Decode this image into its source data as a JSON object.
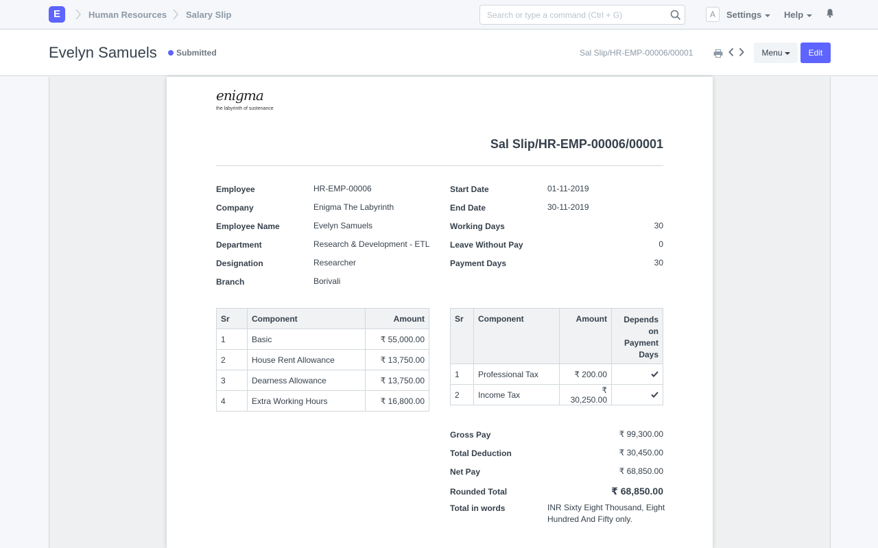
{
  "navbar": {
    "logo": "E",
    "breadcrumbs": [
      "Human Resources",
      "Salary Slip"
    ],
    "search_placeholder": "Search or type a command (Ctrl + G)",
    "avatar": "A",
    "settings": "Settings",
    "help": "Help"
  },
  "header": {
    "title": "Evelyn Samuels",
    "status": "Submitted",
    "doc_name": "Sal Slip/HR-EMP-00006/00001",
    "menu": "Menu",
    "edit": "Edit"
  },
  "slip": {
    "brand": "enigma",
    "tagline": "the labyrinth of sustenance",
    "title": "Sal Slip/HR-EMP-00006/00001",
    "left_fields": [
      {
        "label": "Employee",
        "value": "HR-EMP-00006"
      },
      {
        "label": "Company",
        "value": "Enigma The Labyrinth"
      },
      {
        "label": "Employee Name",
        "value": "Evelyn Samuels"
      },
      {
        "label": "Department",
        "value": "Research & Development - ETL"
      },
      {
        "label": "Designation",
        "value": "Researcher"
      },
      {
        "label": "Branch",
        "value": "Borivali"
      }
    ],
    "right_fields": [
      {
        "label": "Start Date",
        "value": "01-11-2019"
      },
      {
        "label": "End Date",
        "value": "30-11-2019"
      },
      {
        "label": "Working Days",
        "value": "30"
      },
      {
        "label": "Leave Without Pay",
        "value": "0"
      },
      {
        "label": "Payment Days",
        "value": "30"
      }
    ],
    "earnings": {
      "headers": [
        "Sr",
        "Component",
        "Amount"
      ],
      "rows": [
        {
          "sr": "1",
          "component": "Basic",
          "amount": "₹ 55,000.00"
        },
        {
          "sr": "2",
          "component": "House Rent Allowance",
          "amount": "₹ 13,750.00"
        },
        {
          "sr": "3",
          "component": "Dearness Allowance",
          "amount": "₹ 13,750.00"
        },
        {
          "sr": "4",
          "component": "Extra Working Hours",
          "amount": "₹ 16,800.00"
        }
      ]
    },
    "deductions": {
      "headers": [
        "Sr",
        "Component",
        "Amount",
        "Depends on Payment Days"
      ],
      "rows": [
        {
          "sr": "1",
          "component": "Professional Tax",
          "amount": "₹ 200.00",
          "depends": true
        },
        {
          "sr": "2",
          "component": "Income Tax",
          "amount": "₹ 30,250.00",
          "depends": true
        }
      ]
    },
    "totals": {
      "gross_pay_label": "Gross Pay",
      "gross_pay": "₹ 99,300.00",
      "total_deduction_label": "Total Deduction",
      "total_deduction": "₹ 30,450.00",
      "net_pay_label": "Net Pay",
      "net_pay": "₹ 68,850.00",
      "rounded_total_label": "Rounded Total",
      "rounded_total": "₹ 68,850.00",
      "total_in_words_label": "Total in words",
      "total_in_words": "INR Sixty Eight Thousand, Eight Hundred And Fifty only."
    }
  }
}
